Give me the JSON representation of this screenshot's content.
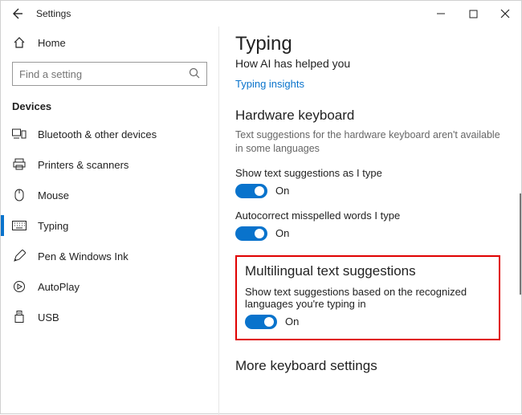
{
  "window": {
    "title": "Settings"
  },
  "sidebar": {
    "home_label": "Home",
    "search_placeholder": "Find a setting",
    "group_label": "Devices",
    "items": [
      {
        "label": "Bluetooth & other devices"
      },
      {
        "label": "Printers & scanners"
      },
      {
        "label": "Mouse"
      },
      {
        "label": "Typing"
      },
      {
        "label": "Pen & Windows Ink"
      },
      {
        "label": "AutoPlay"
      },
      {
        "label": "USB"
      }
    ]
  },
  "page": {
    "title": "Typing",
    "subtitle": "How AI has helped you",
    "insights_link": "Typing insights",
    "hardware": {
      "heading": "Hardware keyboard",
      "desc": "Text suggestions for the hardware keyboard aren't available in some languages",
      "suggestions_label": "Show text suggestions as I type",
      "suggestions_state": "On",
      "autocorrect_label": "Autocorrect misspelled words I type",
      "autocorrect_state": "On"
    },
    "multilingual": {
      "heading": "Multilingual text suggestions",
      "desc": "Show text suggestions based on the recognized languages you're typing in",
      "state": "On"
    },
    "more_heading": "More keyboard settings"
  }
}
